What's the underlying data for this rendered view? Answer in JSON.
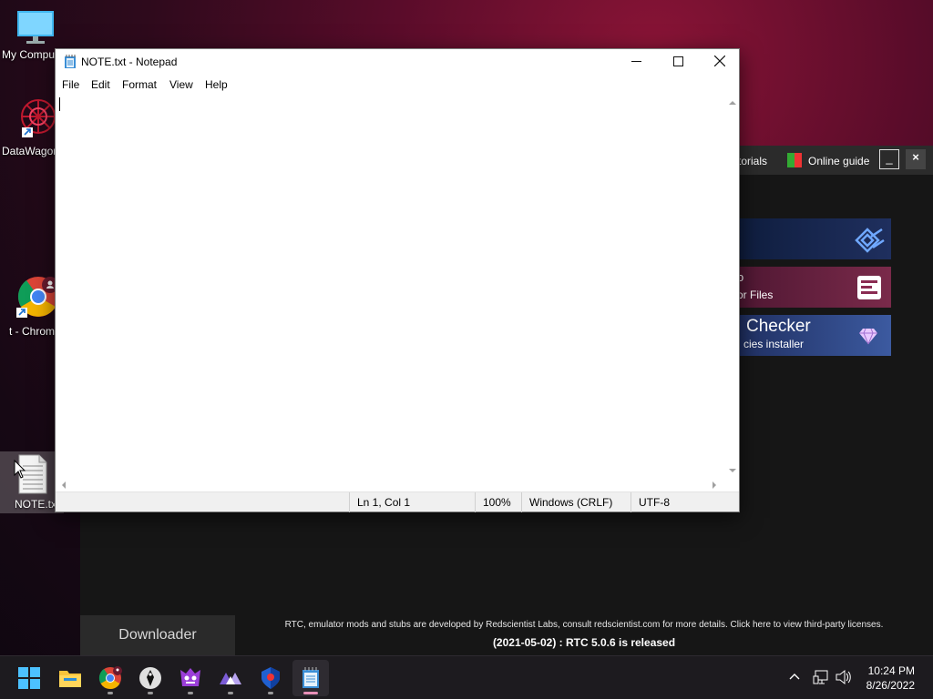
{
  "desktop": {
    "icons": [
      {
        "label": "My Compu"
      },
      {
        "label": "DataWagon"
      },
      {
        "label": "t - Chrom"
      },
      {
        "label": "NOTE.txt"
      }
    ]
  },
  "launcher": {
    "tabs": {
      "tutorials": "torials",
      "online_guide": "Online guide"
    },
    "controls": {
      "minimize": "_",
      "close": "×"
    },
    "cards": [
      {
        "line1": "",
        "line2": ""
      },
      {
        "line1": "o",
        "line2": "or Files"
      },
      {
        "line1": "Checker",
        "line2": "cies installer"
      }
    ],
    "downloader": "Downloader",
    "info": "RTC, emulator mods and stubs are developed by Redscientist Labs, consult redscientist.com for more details. Click here to view third-party licenses.",
    "release": "(2021-05-02) : RTC 5.0.6 is released"
  },
  "notepad": {
    "title": "NOTE.txt - Notepad",
    "menu": [
      "File",
      "Edit",
      "Format",
      "View",
      "Help"
    ],
    "content": "",
    "status": {
      "position": "Ln 1, Col 1",
      "zoom": "100%",
      "line_ending": "Windows (CRLF)",
      "encoding": "UTF-8"
    }
  },
  "taskbar": {
    "clock_time": "10:24 PM",
    "clock_date": "8/26/2022"
  }
}
